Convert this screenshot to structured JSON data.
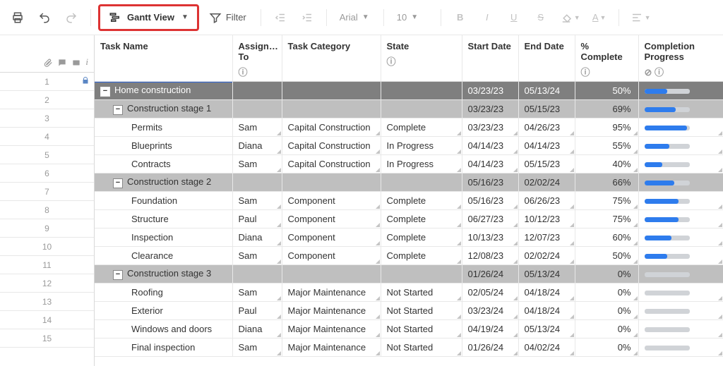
{
  "toolbar": {
    "gantt_label": "Gantt View",
    "filter_label": "Filter",
    "font_label": "Arial",
    "size_label": "10"
  },
  "columns": {
    "name": "Task Name",
    "assign": "Assign… To",
    "category": "Task Category",
    "state": "State",
    "start": "Start Date",
    "end": "End Date",
    "pct": "% Complete",
    "progress": "Completion Progress"
  },
  "row_numbers": [
    "1",
    "2",
    "3",
    "4",
    "5",
    "6",
    "7",
    "8",
    "9",
    "10",
    "11",
    "12",
    "13",
    "14",
    "15"
  ],
  "rows": [
    {
      "level": 0,
      "name": "Home construction",
      "assign": "",
      "category": "",
      "state": "",
      "start": "03/23/23",
      "end": "05/13/24",
      "pct": "50%",
      "progress": 50
    },
    {
      "level": 1,
      "name": "Construction stage 1",
      "assign": "",
      "category": "",
      "state": "",
      "start": "03/23/23",
      "end": "05/15/23",
      "pct": "69%",
      "progress": 69
    },
    {
      "level": 2,
      "name": "Permits",
      "assign": "Sam",
      "category": "Capital Construction",
      "state": "Complete",
      "start": "03/23/23",
      "end": "04/26/23",
      "pct": "95%",
      "progress": 95
    },
    {
      "level": 2,
      "name": "Blueprints",
      "assign": "Diana",
      "category": "Capital Construction",
      "state": "In Progress",
      "start": "04/14/23",
      "end": "04/14/23",
      "pct": "55%",
      "progress": 55
    },
    {
      "level": 2,
      "name": "Contracts",
      "assign": "Sam",
      "category": "Capital Construction",
      "state": "In Progress",
      "start": "04/14/23",
      "end": "05/15/23",
      "pct": "40%",
      "progress": 40
    },
    {
      "level": 1,
      "name": "Construction stage 2",
      "assign": "",
      "category": "",
      "state": "",
      "start": "05/16/23",
      "end": "02/02/24",
      "pct": "66%",
      "progress": 66
    },
    {
      "level": 2,
      "name": "Foundation",
      "assign": "Sam",
      "category": "Component",
      "state": "Complete",
      "start": "05/16/23",
      "end": "06/26/23",
      "pct": "75%",
      "progress": 75
    },
    {
      "level": 2,
      "name": "Structure",
      "assign": "Paul",
      "category": "Component",
      "state": "Complete",
      "start": "06/27/23",
      "end": "10/12/23",
      "pct": "75%",
      "progress": 75
    },
    {
      "level": 2,
      "name": "Inspection",
      "assign": "Diana",
      "category": "Component",
      "state": "Complete",
      "start": "10/13/23",
      "end": "12/07/23",
      "pct": "60%",
      "progress": 60
    },
    {
      "level": 2,
      "name": "Clearance",
      "assign": "Sam",
      "category": "Component",
      "state": "Complete",
      "start": "12/08/23",
      "end": "02/02/24",
      "pct": "50%",
      "progress": 50
    },
    {
      "level": 1,
      "name": "Construction stage 3",
      "assign": "",
      "category": "",
      "state": "",
      "start": "01/26/24",
      "end": "05/13/24",
      "pct": "0%",
      "progress": 0
    },
    {
      "level": 2,
      "name": "Roofing",
      "assign": "Sam",
      "category": "Major Maintenance",
      "state": "Not Started",
      "start": "02/05/24",
      "end": "04/18/24",
      "pct": "0%",
      "progress": 0
    },
    {
      "level": 2,
      "name": "Exterior",
      "assign": "Paul",
      "category": "Major Maintenance",
      "state": "Not Started",
      "start": "03/23/24",
      "end": "04/18/24",
      "pct": "0%",
      "progress": 0
    },
    {
      "level": 2,
      "name": "Windows and doors",
      "assign": "Diana",
      "category": "Major Maintenance",
      "state": "Not Started",
      "start": "04/19/24",
      "end": "05/13/24",
      "pct": "0%",
      "progress": 0
    },
    {
      "level": 2,
      "name": "Final inspection",
      "assign": "Sam",
      "category": "Major Maintenance",
      "state": "Not Started",
      "start": "01/26/24",
      "end": "04/02/24",
      "pct": "0%",
      "progress": 0
    }
  ]
}
